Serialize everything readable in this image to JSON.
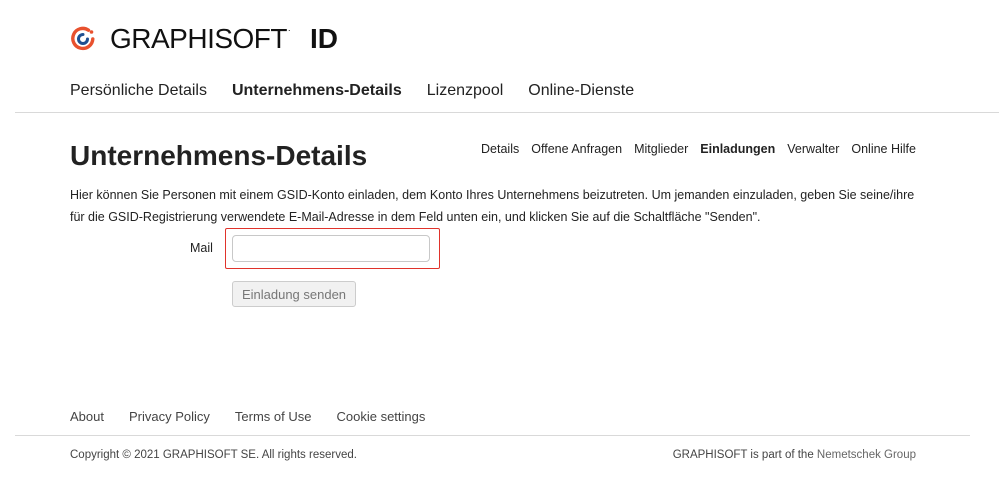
{
  "brand": {
    "wordmark": "GRAPHISOFT",
    "trademark": ".",
    "suffix": "ID",
    "accent_color": "#e8512e",
    "accent_color_2": "#1d4f91"
  },
  "main_nav": {
    "items": [
      {
        "label": "Persönliche Details",
        "active": false
      },
      {
        "label": "Unternehmens-Details",
        "active": true
      },
      {
        "label": "Lizenzpool",
        "active": false
      },
      {
        "label": "Online-Dienste",
        "active": false
      }
    ]
  },
  "page": {
    "title": "Unternehmens-Details",
    "intro": "Hier können Sie Personen mit einem GSID-Konto einladen, dem Konto Ihres Unternehmens beizutreten. Um jemanden einzuladen, geben Sie seine/ihre für die GSID-Registrierung verwendete E-Mail-Adresse in dem Feld unten ein, und klicken Sie auf die Schaltfläche \"Senden\"."
  },
  "sub_nav": {
    "items": [
      {
        "label": "Details",
        "active": false
      },
      {
        "label": "Offene Anfragen",
        "active": false
      },
      {
        "label": "Mitglieder",
        "active": false
      },
      {
        "label": "Einladungen",
        "active": true
      },
      {
        "label": "Verwalter",
        "active": false
      },
      {
        "label": "Online Hilfe",
        "active": false
      }
    ]
  },
  "form": {
    "mail_label": "Mail",
    "mail_value": "",
    "mail_placeholder": "",
    "highlight_color": "#e0332b",
    "send_label": "Einladung senden"
  },
  "footer": {
    "links": [
      "About",
      "Privacy Policy",
      "Terms of Use",
      "Cookie settings"
    ],
    "copyright": "Copyright © 2021 GRAPHISOFT SE. All rights reserved.",
    "part_of_prefix": "GRAPHISOFT is part of the ",
    "part_of_link": "Nemetschek Group"
  }
}
